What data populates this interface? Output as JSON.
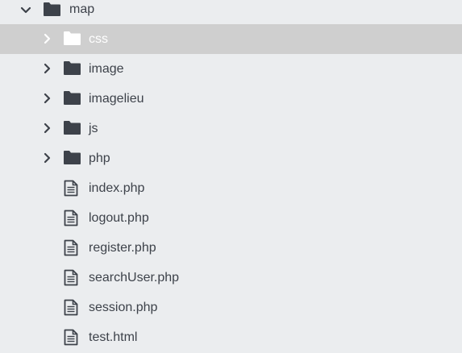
{
  "explorer": {
    "root": {
      "name": "map",
      "expanded": true,
      "icon": "folder-icon"
    },
    "folders": [
      {
        "name": "css",
        "selected": true,
        "icon": "folder-icon"
      },
      {
        "name": "image",
        "icon": "folder-icon"
      },
      {
        "name": "imagelieu",
        "icon": "folder-icon"
      },
      {
        "name": "js",
        "icon": "folder-icon"
      },
      {
        "name": "php",
        "icon": "folder-icon"
      }
    ],
    "files": [
      {
        "name": "index.php",
        "icon": "file-icon"
      },
      {
        "name": "logout.php",
        "icon": "file-icon"
      },
      {
        "name": "register.php",
        "icon": "file-icon"
      },
      {
        "name": "searchUser.php",
        "icon": "file-icon"
      },
      {
        "name": "session.php",
        "icon": "file-icon"
      },
      {
        "name": "test.html",
        "icon": "file-icon"
      }
    ]
  },
  "colors": {
    "background": "#ebedef",
    "selected_row": "#cfcfcf",
    "icon": "#3d424a",
    "selected_icon": "#ffffff"
  }
}
